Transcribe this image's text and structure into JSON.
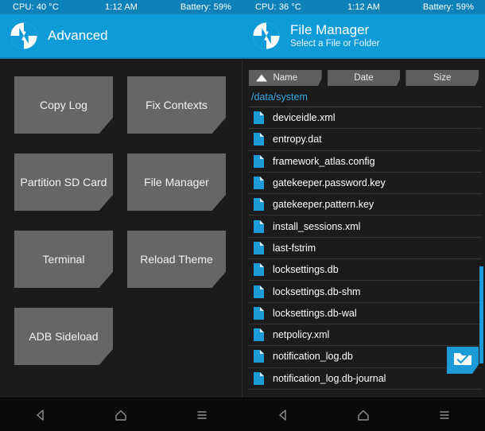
{
  "status_bars": [
    {
      "cpu": "CPU: 40 °C",
      "time": "1:12 AM",
      "battery": "Battery: 59%"
    },
    {
      "cpu": "CPU: 36 °C",
      "time": "1:12 AM",
      "battery": "Battery: 59%"
    }
  ],
  "left_pane": {
    "header": {
      "title": "Advanced",
      "subtitle": "",
      "logo_icon": "twrp-logo-icon"
    },
    "buttons": [
      {
        "label": "Copy Log"
      },
      {
        "label": "Fix Contexts"
      },
      {
        "label": "Partition SD Card"
      },
      {
        "label": "File Manager"
      },
      {
        "label": "Terminal"
      },
      {
        "label": "Reload Theme"
      },
      {
        "label": "ADB Sideload"
      }
    ]
  },
  "right_pane": {
    "header": {
      "title": "File Manager",
      "subtitle": "Select a File or Folder",
      "logo_icon": "twrp-logo-icon"
    },
    "sort_buttons": [
      {
        "label": "Name",
        "active": true,
        "sort_icon": "sort-ascending-triangle-icon"
      },
      {
        "label": "Date",
        "active": false
      },
      {
        "label": "Size",
        "active": false
      }
    ],
    "path": "/data/system",
    "files": [
      {
        "name": "deviceidle.xml",
        "icon": "file-document-icon"
      },
      {
        "name": "entropy.dat",
        "icon": "file-document-icon"
      },
      {
        "name": "framework_atlas.config",
        "icon": "file-document-icon"
      },
      {
        "name": "gatekeeper.password.key",
        "icon": "file-document-icon"
      },
      {
        "name": "gatekeeper.pattern.key",
        "icon": "file-document-icon"
      },
      {
        "name": "install_sessions.xml",
        "icon": "file-document-icon"
      },
      {
        "name": "last-fstrim",
        "icon": "file-document-icon"
      },
      {
        "name": "locksettings.db",
        "icon": "file-document-icon"
      },
      {
        "name": "locksettings.db-shm",
        "icon": "file-document-icon"
      },
      {
        "name": "locksettings.db-wal",
        "icon": "file-document-icon"
      },
      {
        "name": "netpolicy.xml",
        "icon": "file-document-icon"
      },
      {
        "name": "notification_log.db",
        "icon": "file-document-icon"
      },
      {
        "name": "notification_log.db-journal",
        "icon": "file-document-icon"
      }
    ],
    "select_button": {
      "icon": "folder-check-select-icon"
    },
    "scrollbar": {
      "visible": true
    }
  },
  "nav_bars": [
    {
      "buttons": [
        {
          "icon": "back-triangle-icon"
        },
        {
          "icon": "home-house-icon"
        },
        {
          "icon": "menu-lines-icon"
        }
      ]
    },
    {
      "buttons": [
        {
          "icon": "back-triangle-icon"
        },
        {
          "icon": "home-house-icon"
        },
        {
          "icon": "menu-lines-icon"
        }
      ]
    }
  ],
  "colors": {
    "accent_blue": "#0f9bd7",
    "statusbar_blue": "#0e82b8",
    "background": "#1b1b1b",
    "button_gray": "#666666",
    "path_blue": "#3aa7e0",
    "scroll_thumb": "#1b9bd8"
  }
}
